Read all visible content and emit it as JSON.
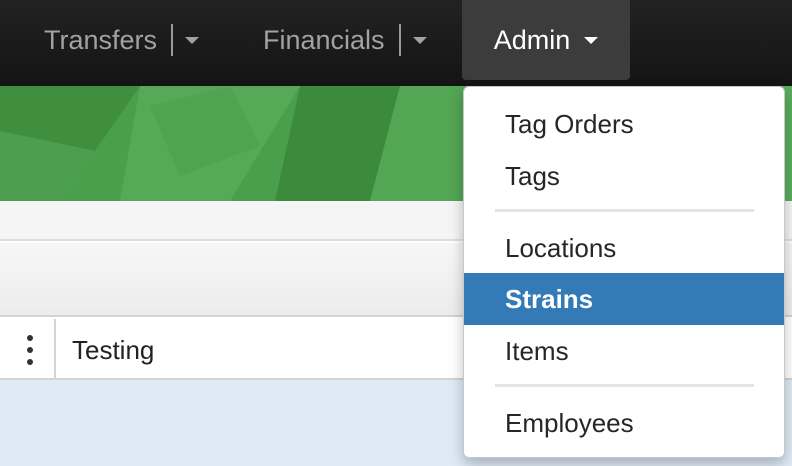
{
  "navbar": {
    "transfers_label": "Transfers",
    "financials_label": "Financials",
    "admin_label": "Admin"
  },
  "table": {
    "column_testing": "Testing"
  },
  "admin_menu": {
    "items": [
      {
        "label": "Tag Orders"
      },
      {
        "label": "Tags"
      },
      {
        "label": "Locations"
      },
      {
        "label": "Strains",
        "state": "highlighted"
      },
      {
        "label": "Items"
      },
      {
        "label": "Employees"
      }
    ]
  },
  "colors": {
    "navbar": "#1b1b1b",
    "banner_green": "#4a9f4c",
    "highlight_blue": "#337ab7",
    "table_body": "#deebf7"
  }
}
